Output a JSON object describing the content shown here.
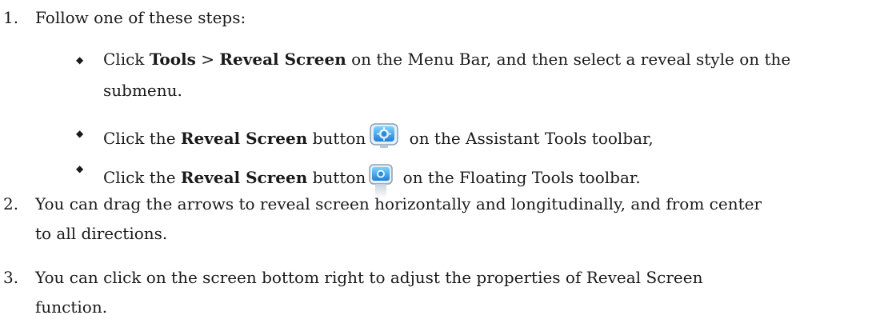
{
  "steps": [
    {
      "number": "1.",
      "text": "Follow one of these steps:",
      "substeps": [
        {
          "pre": "Click ",
          "bold1": "Tools",
          "mid": " > ",
          "bold2": "Reveal Screen",
          "post_line1": " on the Menu Bar, and then select a reveal style on the",
          "post_line2": "submenu."
        },
        {
          "pre": "Click the ",
          "bold": "Reveal Screen",
          "mid": " button",
          "post": " on the Assistant Tools toolbar,"
        },
        {
          "pre": "Click the ",
          "bold": "Reveal Screen",
          "mid": " button",
          "post": " on the Floating Tools toolbar."
        }
      ]
    },
    {
      "number": "2.",
      "line1": "You can drag the arrows to reveal screen horizontally and longitudinally, and from center",
      "line2": "to all directions."
    },
    {
      "number": "3.",
      "line1": "You can click on the screen bottom right to adjust the properties of Reveal Screen",
      "line2": "function."
    }
  ],
  "bullet_glyph": "◆",
  "icons": {
    "reveal_screen_large": "monitor-reveal-icon",
    "reveal_screen_small": "monitor-reveal-icon-small"
  }
}
